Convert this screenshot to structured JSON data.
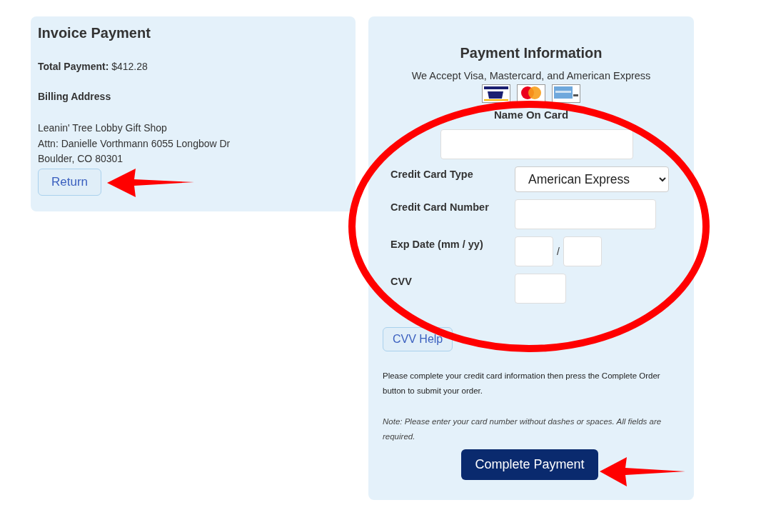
{
  "invoice": {
    "title": "Invoice Payment",
    "total_label": "Total Payment:",
    "total_value": "$412.28",
    "billing_heading": "Billing Address",
    "address_lines": [
      "Leanin' Tree Lobby Gift Shop",
      "Attn: Danielle Vorthmann 6055 Longbow Dr",
      "Boulder, CO 80301"
    ],
    "return_button": "Return"
  },
  "payment": {
    "title": "Payment Information",
    "accepted": "We Accept Visa, Mastercard, and American Express",
    "name_label": "Name On Card",
    "fields": [
      {
        "kind": "select",
        "label": "Credit Card Type",
        "value": "American Express"
      },
      {
        "kind": "wide",
        "label": "Credit Card Number"
      },
      {
        "kind": "date",
        "label": "Exp Date (mm / yy)",
        "separator": "/"
      },
      {
        "kind": "short",
        "label": "CVV"
      }
    ],
    "cvv_help_button": "CVV Help",
    "instructions": "Please complete your credit card information then press the Complete Order button to submit your order.",
    "note": "Note: Please enter your card number without dashes or spaces. All fields are required.",
    "submit_button": "Complete Payment"
  }
}
